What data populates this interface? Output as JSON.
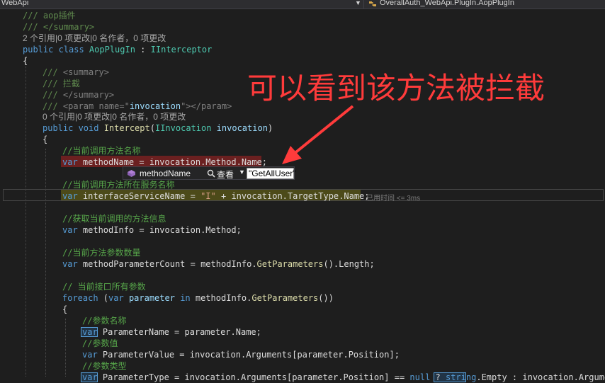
{
  "topbar": {
    "left_title": "WebApi",
    "right_title": "OverallAuth_WebApi.PlugIn.AopPlugIn"
  },
  "code": {
    "l1": "/// aop插件",
    "l2": "/// </summary>",
    "l3": "2 个引用|0 项更改|0 名作者，0 项更改",
    "l4_kw": "public class ",
    "l4_type": "AopPlugIn",
    "l4_rest": " : ",
    "l4_iface": "IInterceptor",
    "l5": "{",
    "l6a": "/// ",
    "l6b": "<summary>",
    "l7": "/// 拦截",
    "l8a": "/// ",
    "l8b": "</summary>",
    "l9a": "/// ",
    "l9b": "<param name=\"",
    "l9c": "invocation",
    "l9d": "\"></param>",
    "l10": "0 个引用|0 项更改|0 名作者，0 项更改",
    "l11_kw": "public void ",
    "l11_m": "Intercept",
    "l11_p1": "(",
    "l11_type": "IInvocation",
    "l11_id": " invocation",
    "l11_p2": ")",
    "l12": "{",
    "l13": "//当前调用方法名称",
    "l14_kw": "var ",
    "l14_rest": "methodName = invocation.Method.Name;",
    "l15": "//当前调用方法所在服务名称",
    "l16_kw": "var ",
    "l16_a": "interfaceServiceName = ",
    "l16_str": "\"I\"",
    "l16_b": " + invocation.TargetType.Name;",
    "l17": "//获取当前调用的方法信息",
    "l18_kw": "var ",
    "l18_a": "methodInfo = invocation.",
    "l18_b": "Method",
    "l18_c": ";",
    "l19": "//当前方法参数数量",
    "l20_kw": "var ",
    "l20_a": "methodParameterCount = methodInfo.",
    "l20_m": "GetParameters",
    "l20_b": "().Length;",
    "l21": "// 当前接口所有参数",
    "l22_kw": "foreach ",
    "l22_a": "(",
    "l22_kw2": "var ",
    "l22_id": "parameter",
    "l22_in": " in ",
    "l22_b": "methodInfo.",
    "l22_m": "GetParameters",
    "l22_c": "())",
    "l23": "{",
    "l24": "//参数名称",
    "l25_kw": "var",
    "l25_a": " ParameterName = parameter.Name;",
    "l26": "//参数值",
    "l27_kw": "var ",
    "l27_a": "ParameterValue = invocation.Arguments[parameter.Position];",
    "l28": "//参数类型",
    "l29_kw": "var",
    "l29_a": " ParameterType = invocation.Arguments[parameter.Position] == ",
    "l29_null": "null",
    "l29_b": " ? ",
    "l29_str": "string",
    "l29_c": ".Empty : invocation.Arguments["
  },
  "elapsed": "已用时间 <= 3ms",
  "datatip": {
    "name": "methodName",
    "view": "查看",
    "value": "\"GetAllUser\""
  },
  "annotation": "可以看到该方法被拦截",
  "colors": {
    "annotation": "#ff3b3b",
    "keyword": "#569cd6",
    "comment": "#57a64a",
    "type": "#4ec9b0"
  }
}
